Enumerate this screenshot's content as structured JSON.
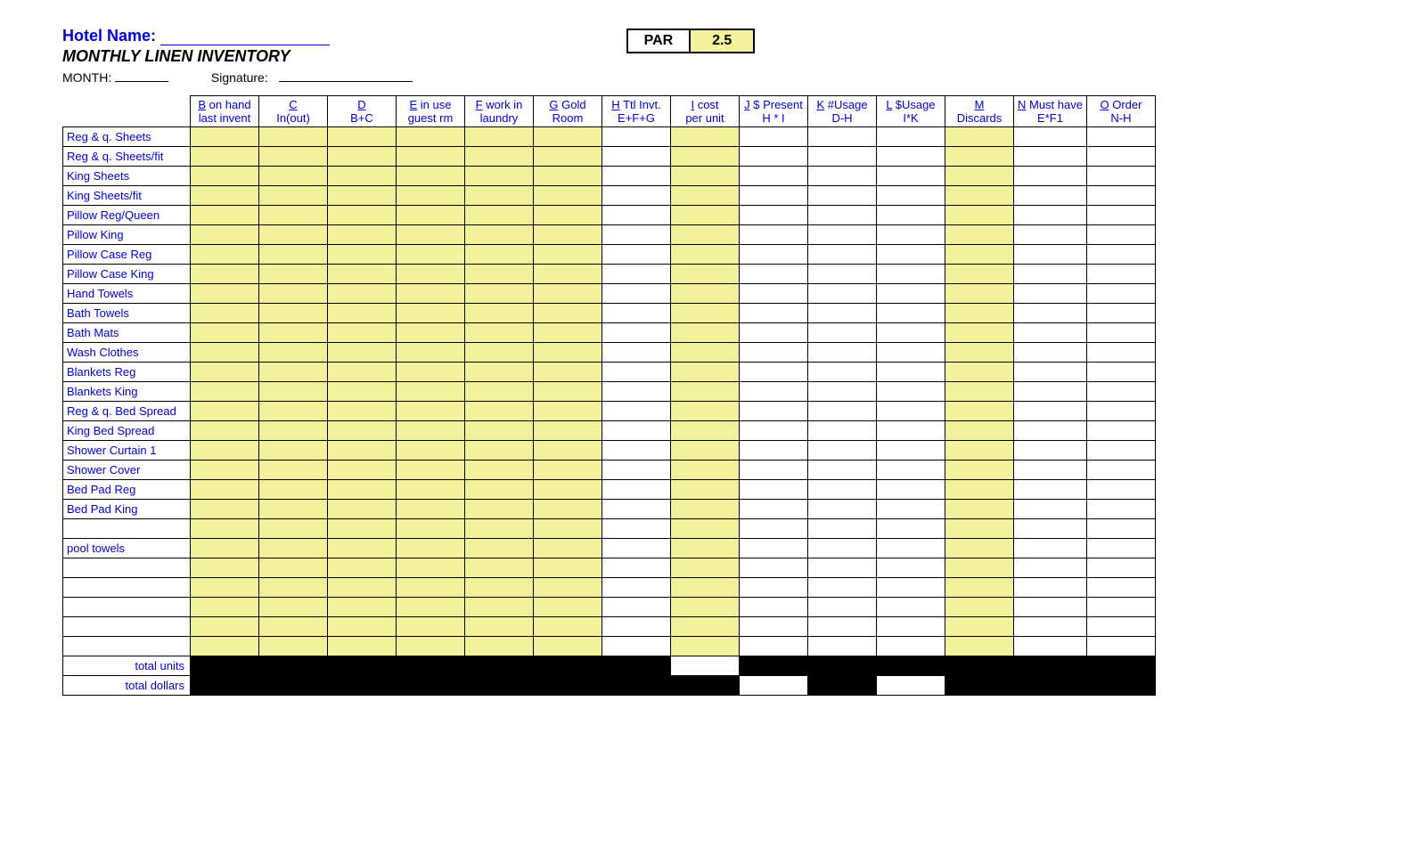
{
  "header": {
    "hotel_name_label": "Hotel Name:",
    "subtitle": "MONTHLY LINEN INVENTORY",
    "month_label": "MONTH:",
    "signature_label": "Signature:",
    "par_label": "PAR",
    "par_value": "2.5"
  },
  "columns": [
    {
      "letter": "B",
      "l1": "on hand",
      "l2": "last invent"
    },
    {
      "letter": "C",
      "l1": "",
      "l2": "In(out)"
    },
    {
      "letter": "D",
      "l1": "",
      "l2": "B+C"
    },
    {
      "letter": "E",
      "l1": "in use",
      "l2": "guest rm"
    },
    {
      "letter": "F",
      "l1": "work in",
      "l2": "laundry"
    },
    {
      "letter": "G",
      "l1": "Gold",
      "l2": "Room"
    },
    {
      "letter": "H",
      "l1": "Ttl Invt.",
      "l2": "E+F+G"
    },
    {
      "letter": "I",
      "l1": "cost",
      "l2": "per unit"
    },
    {
      "letter": "J",
      "l1": "$ Present",
      "l2": "H * I"
    },
    {
      "letter": "K",
      "l1": "#Usage",
      "l2": "D-H"
    },
    {
      "letter": "L",
      "l1": "$Usage",
      "l2": "I*K"
    },
    {
      "letter": "M",
      "l1": "",
      "l2": "Discards"
    },
    {
      "letter": "N",
      "l1": "Must have",
      "l2": "E*F1"
    },
    {
      "letter": "O",
      "l1": "Order",
      "l2": "N-H"
    }
  ],
  "row_labels": [
    "Reg & q. Sheets",
    "Reg & q.  Sheets/fit",
    "King Sheets",
    "King Sheets/fit",
    "Pillow Reg/Queen",
    "Pillow King",
    "Pillow Case Reg",
    "Pillow Case King",
    "Hand Towels",
    "Bath Towels",
    "Bath Mats",
    "Wash Clothes",
    "Blankets Reg",
    "Blankets King",
    "Reg & q. Bed Spread",
    "King Bed Spread",
    "Shower Curtain 1",
    "Shower Cover",
    "Bed Pad  Reg",
    "Bed Pad King",
    "",
    "pool towels",
    "",
    "",
    "",
    "",
    ""
  ],
  "yellow_columns": [
    0,
    1,
    2,
    3,
    4,
    5,
    7,
    11
  ],
  "totals": {
    "units_label": "total units",
    "dollars_label": "total dollars"
  }
}
